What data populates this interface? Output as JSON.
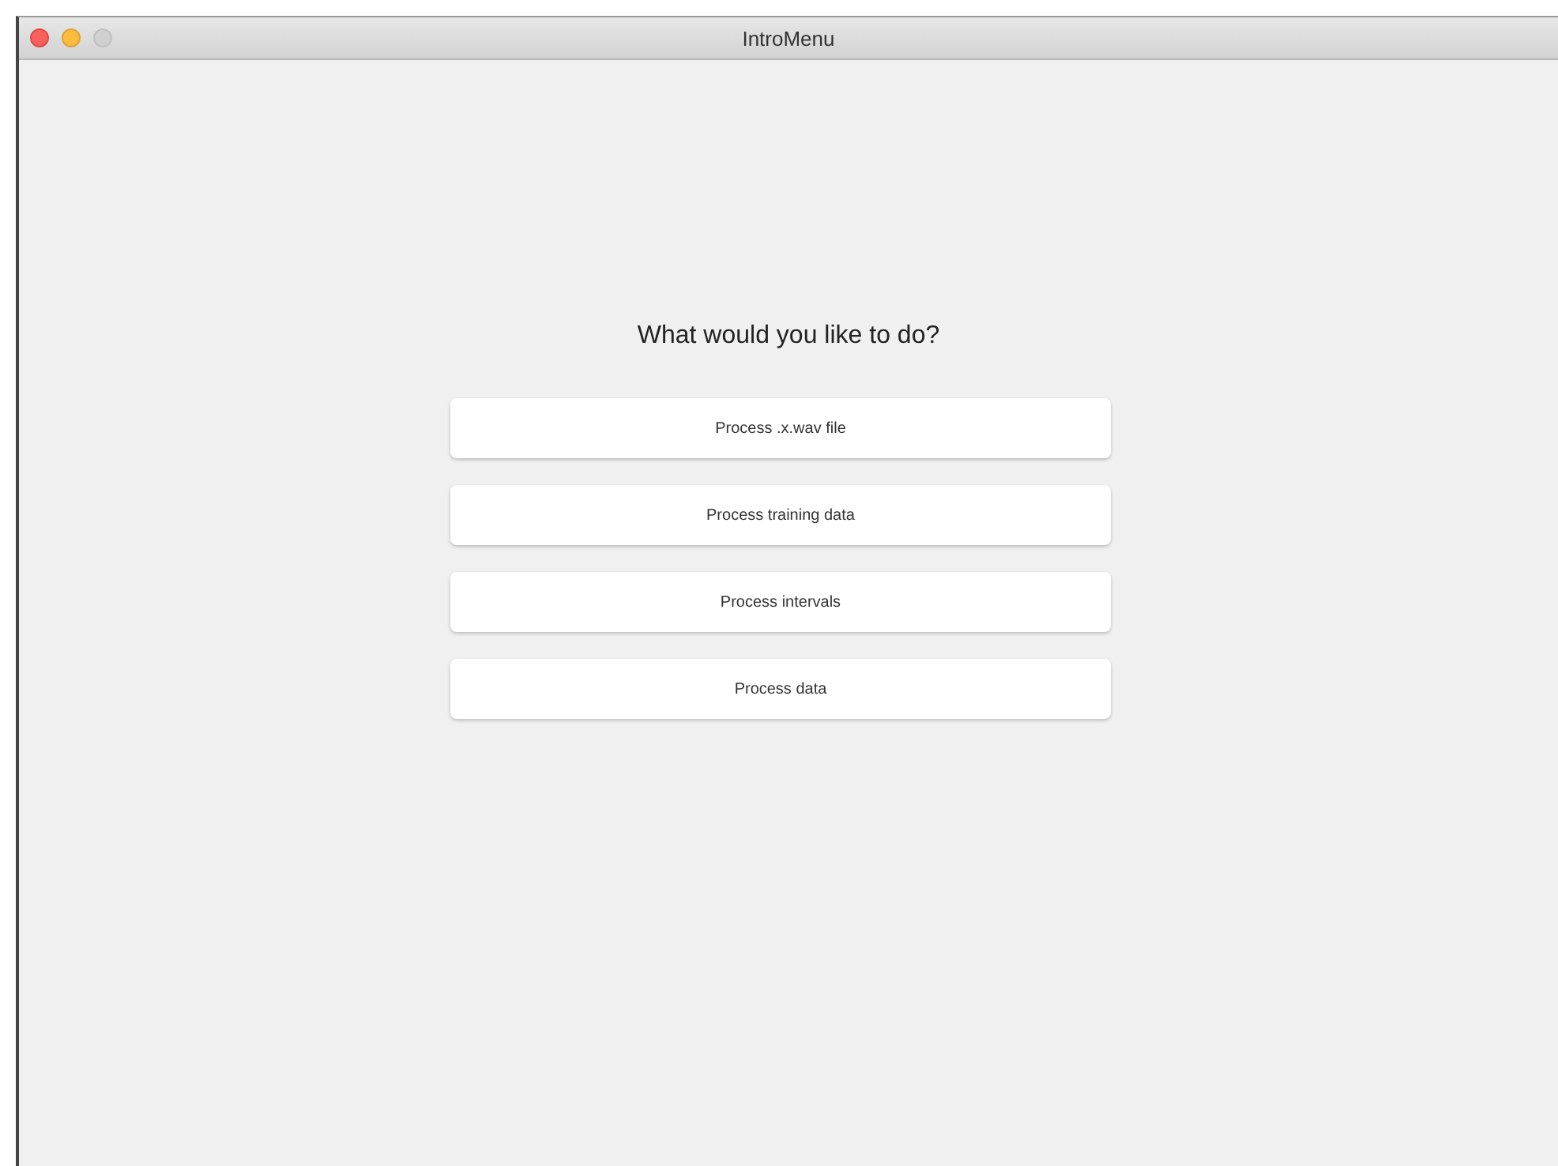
{
  "window": {
    "title": "IntroMenu"
  },
  "heading": "What would you like to do?",
  "buttons": [
    {
      "label": "Process .x.wav file"
    },
    {
      "label": "Process training data"
    },
    {
      "label": "Process intervals"
    },
    {
      "label": "Process data"
    }
  ]
}
